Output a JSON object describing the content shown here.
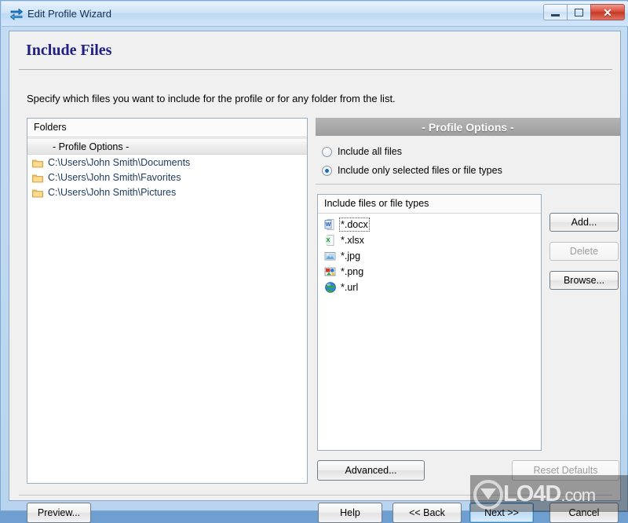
{
  "window": {
    "title": "Edit Profile Wizard",
    "icon": "sync-arrows-icon",
    "controls": {
      "minimize": "minimize-button",
      "maximize": "restore-button",
      "close": "✕"
    }
  },
  "header": {
    "title": "Include Files",
    "subtitle": "Specify which files you want to include for the profile or for any folder from the list."
  },
  "folders_panel": {
    "column_header": "Folders",
    "items": [
      {
        "label": "- Profile Options -",
        "selected": true,
        "icon": "none"
      },
      {
        "label": "C:\\Users\\John Smith\\Documents",
        "selected": false,
        "icon": "folder-icon"
      },
      {
        "label": "C:\\Users\\John Smith\\Favorites",
        "selected": false,
        "icon": "folder-icon"
      },
      {
        "label": "C:\\Users\\John Smith\\Pictures",
        "selected": false,
        "icon": "folder-icon"
      }
    ]
  },
  "profile_options": {
    "header": "- Profile Options -",
    "radios": [
      {
        "label": "Include all files",
        "selected": false
      },
      {
        "label": "Include only selected files or file types",
        "selected": true
      }
    ]
  },
  "include_list": {
    "column_header": "Include files or file types",
    "items": [
      {
        "label": "*.docx",
        "icon": "word-document-icon",
        "focused": true
      },
      {
        "label": "*.xlsx",
        "icon": "excel-spreadsheet-icon",
        "focused": false
      },
      {
        "label": "*.jpg",
        "icon": "image-file-icon",
        "focused": false
      },
      {
        "label": "*.png",
        "icon": "png-image-icon",
        "focused": false
      },
      {
        "label": "*.url",
        "icon": "globe-url-icon",
        "focused": false
      }
    ]
  },
  "side_buttons": {
    "add": "Add...",
    "delete": "Delete",
    "browse": "Browse..."
  },
  "lower_buttons": {
    "advanced": "Advanced...",
    "reset_defaults": "Reset Defaults"
  },
  "footer_buttons": {
    "preview": "Preview...",
    "help": "Help",
    "back": "<< Back",
    "next": "Next >>",
    "cancel": "Cancel"
  },
  "watermark": {
    "text": "LO4D",
    "suffix": ".com"
  },
  "colors": {
    "title_text": "#202080",
    "path_text": "#1b3a5c",
    "header_band": "#9e9e9e",
    "radio_accent": "#1668c8",
    "default_button_border": "#3c7fb1",
    "close_button": "#c63826"
  }
}
